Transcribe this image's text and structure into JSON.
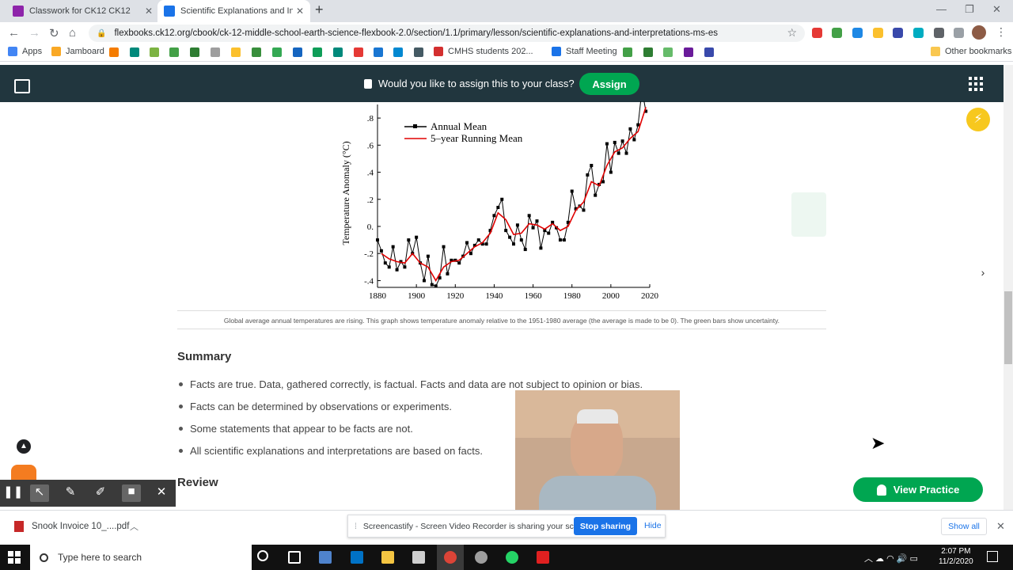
{
  "browser": {
    "tabs": [
      {
        "title": "Classwork for CK12 CK12",
        "favicon_color": "#8e24aa",
        "active": false
      },
      {
        "title": "Scientific Explanations and Interp",
        "favicon_color": "#1a73e8",
        "active": true
      }
    ],
    "url": "flexbooks.ck12.org/cbook/ck-12-middle-school-earth-science-flexbook-2.0/section/1.1/primary/lesson/scientific-explanations-and-interpretations-ms-es",
    "bookmarks": [
      "Apps",
      "Jamboard",
      "CMHS students 202...",
      "Staff Meeting"
    ],
    "other_bookmarks": "Other bookmarks"
  },
  "ck12": {
    "assign_prompt": "Would you like to assign this to your class?",
    "assign_label": "Assign",
    "brand_green": "#00a651",
    "header_color": "#21363e"
  },
  "chart_data": {
    "type": "line",
    "title": "",
    "xlabel": "",
    "ylabel": "Temperature Anomaly (°C)",
    "xlim": [
      1880,
      2020
    ],
    "ylim": [
      -0.45,
      0.9
    ],
    "x_ticks": [
      "1880",
      "1900",
      "1920",
      "1940",
      "1960",
      "1980",
      "2000",
      "2020"
    ],
    "y_ticks": [
      ".8",
      ".6",
      ".4",
      ".2",
      "0.",
      "-.2",
      "-.4"
    ],
    "legend": "top-left",
    "series": [
      {
        "name": "Annual Mean",
        "color": "#000000",
        "x": [
          1880,
          1882,
          1884,
          1886,
          1888,
          1890,
          1892,
          1894,
          1896,
          1898,
          1900,
          1902,
          1904,
          1906,
          1908,
          1910,
          1912,
          1914,
          1916,
          1918,
          1920,
          1922,
          1924,
          1926,
          1928,
          1930,
          1932,
          1934,
          1936,
          1938,
          1940,
          1942,
          1944,
          1946,
          1948,
          1950,
          1952,
          1954,
          1956,
          1958,
          1960,
          1962,
          1964,
          1966,
          1968,
          1970,
          1972,
          1974,
          1976,
          1978,
          1980,
          1982,
          1984,
          1986,
          1988,
          1990,
          1992,
          1994,
          1996,
          1998,
          2000,
          2002,
          2004,
          2006,
          2008,
          2010,
          2012,
          2014,
          2016,
          2018
        ],
        "values": [
          -0.1,
          -0.18,
          -0.27,
          -0.3,
          -0.15,
          -0.32,
          -0.26,
          -0.3,
          -0.1,
          -0.2,
          -0.08,
          -0.27,
          -0.4,
          -0.22,
          -0.43,
          -0.44,
          -0.38,
          -0.15,
          -0.35,
          -0.25,
          -0.25,
          -0.27,
          -0.22,
          -0.12,
          -0.2,
          -0.14,
          -0.1,
          -0.13,
          -0.13,
          -0.03,
          0.08,
          0.14,
          0.2,
          -0.03,
          -0.08,
          -0.13,
          0.01,
          -0.1,
          -0.17,
          0.08,
          -0.01,
          0.04,
          -0.16,
          -0.03,
          -0.05,
          0.03,
          -0.01,
          -0.1,
          -0.1,
          0.03,
          0.26,
          0.13,
          0.15,
          0.12,
          0.38,
          0.45,
          0.23,
          0.31,
          0.33,
          0.61,
          0.4,
          0.62,
          0.54,
          0.63,
          0.54,
          0.72,
          0.64,
          0.75,
          1.01,
          0.85
        ]
      },
      {
        "name": "5–year Running Mean",
        "color": "#e00000",
        "x": [
          1882,
          1886,
          1890,
          1894,
          1898,
          1902,
          1906,
          1910,
          1914,
          1918,
          1922,
          1926,
          1930,
          1934,
          1938,
          1942,
          1946,
          1950,
          1954,
          1958,
          1962,
          1966,
          1970,
          1974,
          1978,
          1982,
          1986,
          1990,
          1994,
          1998,
          2002,
          2006,
          2010,
          2014,
          2018
        ],
        "values": [
          -0.2,
          -0.24,
          -0.26,
          -0.27,
          -0.2,
          -0.27,
          -0.3,
          -0.4,
          -0.3,
          -0.26,
          -0.25,
          -0.2,
          -0.15,
          -0.12,
          -0.05,
          0.1,
          0.05,
          -0.06,
          -0.05,
          0.02,
          0.01,
          -0.02,
          0.02,
          -0.03,
          0.0,
          0.12,
          0.18,
          0.33,
          0.3,
          0.45,
          0.55,
          0.58,
          0.65,
          0.7,
          0.88
        ]
      }
    ]
  },
  "content": {
    "caption": "Global average annual temperatures are rising. This graph shows temperature anomaly relative to the 1951-1980 average (the average is made to be 0). The green bars show uncertainty.",
    "summary_heading": "Summary",
    "summary_items": [
      "Facts are true. Data, gathered correctly, is factual. Facts and data are not subject to opinion or bias.",
      "Facts can be determined by observations or experiments.",
      "Some statements that appear to be facts are not.",
      "All scientific explanations and interpretations are based on facts."
    ],
    "review_heading": "Review",
    "view_practice": "View Practice"
  },
  "downloads": {
    "file": "Snook Invoice 10_....pdf",
    "share_text": "Screencastify - Screen Video Recorder is sharing your screen.",
    "stop_sharing": "Stop sharing",
    "hide": "Hide",
    "show_all": "Show all"
  },
  "taskbar": {
    "search_placeholder": "Type here to search",
    "time": "2:07 PM",
    "date": "11/2/2020"
  }
}
